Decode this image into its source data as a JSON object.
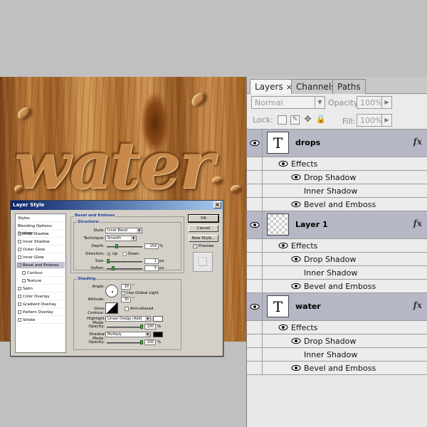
{
  "canvas": {
    "text": "water"
  },
  "panel": {
    "tabs": [
      {
        "label": "Layers",
        "close": "×"
      },
      {
        "label": "Channels"
      },
      {
        "label": "Paths"
      }
    ],
    "blend_mode": "Normal",
    "opacity_label": "Opacity:",
    "opacity_value": "100%",
    "lock_label": "Lock:",
    "fill_label": "Fill:",
    "fill_value": "100%",
    "layers": [
      {
        "name": "drops",
        "thumb": "T",
        "fx": "fx",
        "effects_label": "Effects",
        "effects": [
          {
            "name": "Drop Shadow",
            "visible": true
          },
          {
            "name": "Inner Shadow",
            "visible": false
          },
          {
            "name": "Bevel and Emboss",
            "visible": true
          }
        ]
      },
      {
        "name": "Layer 1",
        "thumb": "",
        "fx": "fx",
        "effects_label": "Effects",
        "effects": [
          {
            "name": "Drop Shadow",
            "visible": true
          },
          {
            "name": "Inner Shadow",
            "visible": false
          },
          {
            "name": "Bevel and Emboss",
            "visible": true
          }
        ]
      },
      {
        "name": "water",
        "thumb": "T",
        "fx": "fx",
        "effects_label": "Effects",
        "effects": [
          {
            "name": "Drop Shadow",
            "visible": true
          },
          {
            "name": "Inner Shadow",
            "visible": false
          },
          {
            "name": "Bevel and Emboss",
            "visible": true
          }
        ]
      }
    ]
  },
  "dialog": {
    "title": "Layer Style",
    "close": "×",
    "styles": [
      {
        "label": "Styles",
        "check": false,
        "header": true
      },
      {
        "label": "Blending Options: Custom",
        "check": false,
        "header": true
      },
      {
        "label": "Drop Shadow",
        "check": true
      },
      {
        "label": "Inner Shadow",
        "check": false
      },
      {
        "label": "Outer Glow",
        "check": false
      },
      {
        "label": "Inner Glow",
        "check": false
      },
      {
        "label": "Bevel and Emboss",
        "check": true,
        "selected": true
      },
      {
        "label": "Contour",
        "check": false,
        "indent": true
      },
      {
        "label": "Texture",
        "check": false,
        "indent": true
      },
      {
        "label": "Satin",
        "check": false
      },
      {
        "label": "Color Overlay",
        "check": false
      },
      {
        "label": "Gradient Overlay",
        "check": false
      },
      {
        "label": "Pattern Overlay",
        "check": false
      },
      {
        "label": "Stroke",
        "check": false
      }
    ],
    "section_title": "Bevel and Emboss",
    "structure": {
      "title": "Structure",
      "style_label": "Style:",
      "style_value": "Inner Bevel",
      "technique_label": "Technique:",
      "technique_value": "Smooth",
      "depth_label": "Depth:",
      "depth_value": "154",
      "depth_unit": "%",
      "direction_label": "Direction:",
      "dir_up": "Up",
      "dir_down": "Down",
      "size_label": "Size:",
      "size_value": "1",
      "size_unit": "px",
      "soften_label": "Soften:",
      "soften_value": "5",
      "soften_unit": "px"
    },
    "shading": {
      "title": "Shading",
      "angle_label": "Angle:",
      "angle_value": "30",
      "angle_unit": "°",
      "global_light": "Use Global Light",
      "altitude_label": "Altitude:",
      "altitude_value": "30",
      "altitude_unit": "°",
      "gloss_label": "Gloss Contour:",
      "anti_aliased": "Anti-aliased",
      "highlight_label": "Highlight Mode:",
      "highlight_value": "Linear Dodge (Add)",
      "hl_opacity_label": "Opacity:",
      "hl_opacity_value": "100",
      "hl_opacity_unit": "%",
      "shadow_label": "Shadow Mode:",
      "shadow_value": "Multiply",
      "sh_opacity_label": "Opacity:",
      "sh_opacity_value": "100",
      "sh_opacity_unit": "%"
    },
    "buttons": {
      "ok": "OK",
      "cancel": "Cancel",
      "new_style": "New Style...",
      "preview": "Preview"
    }
  }
}
